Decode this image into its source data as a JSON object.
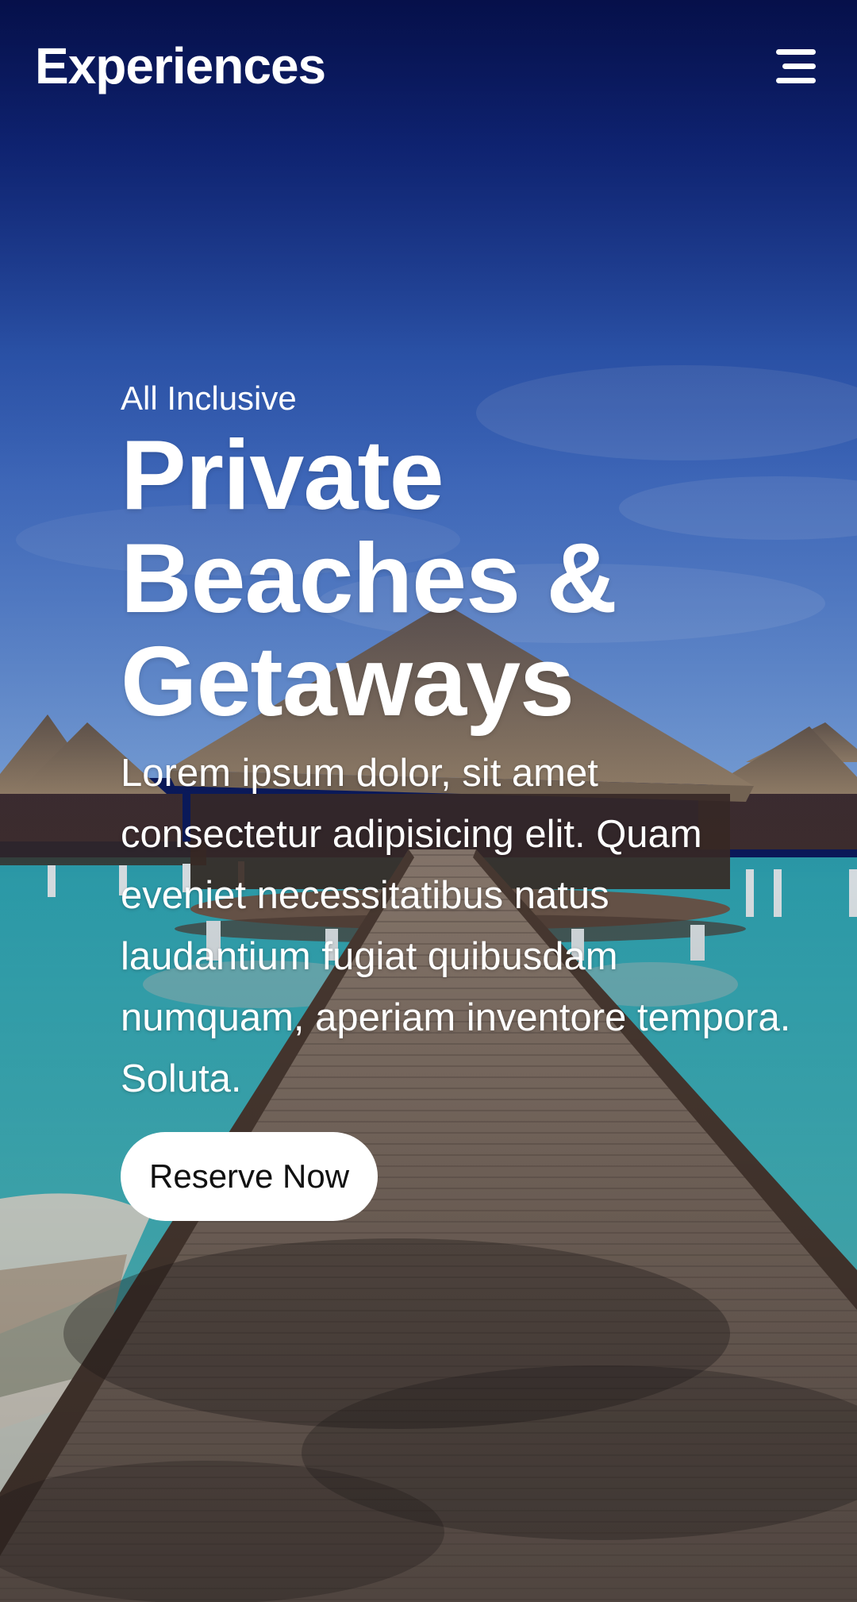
{
  "header": {
    "brand": "Experiences",
    "menu_icon": "hamburger-menu-icon"
  },
  "hero": {
    "eyebrow": "All Inclusive",
    "headline": "Private Beaches & Getaways",
    "body": "Lorem ipsum dolor, sit amet consectetur adipisicing elit. Quam eveniet necessitatibus natus laudantium fugiat quibusdam numquam, aperiam inventore tempora. Soluta.",
    "cta_label": "Reserve Now",
    "background": "tropical-overwater-bungalows-boardwalk-photo"
  },
  "colors": {
    "sky_top": "#0b1a5c",
    "sky_mid": "#2f5fbd",
    "water": "#3fb7c4",
    "text": "#ffffff",
    "button_bg": "#ffffff",
    "button_text": "#111111"
  }
}
